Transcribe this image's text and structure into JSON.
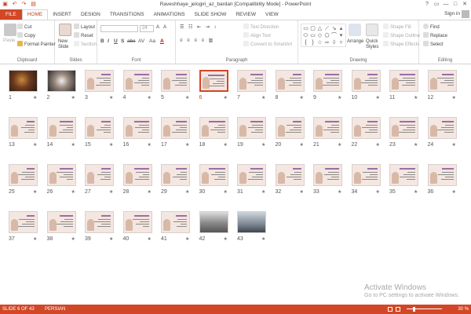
{
  "window": {
    "title": "Raveshhaye_jelogiri_az_bardari [Compatibility Mode] - PowerPoint",
    "qat": [
      "save-icon",
      "undo-icon",
      "redo-icon",
      "slideshow-icon"
    ],
    "controls": [
      "?",
      "▭",
      "—",
      "□",
      "✕"
    ]
  },
  "tabs": [
    "FILE",
    "HOME",
    "INSERT",
    "DESIGN",
    "TRANSITIONS",
    "ANIMATIONS",
    "SLIDE SHOW",
    "REVIEW",
    "VIEW"
  ],
  "active_tab": "HOME",
  "signin": "Sign in",
  "ribbon": {
    "clipboard": {
      "label": "Clipboard",
      "paste": "Paste",
      "cut": "Cut",
      "copy": "Copy",
      "format_painter": "Format Painter"
    },
    "slides": {
      "label": "Slides",
      "new_slide": "New",
      "new_slide2": "Slide",
      "layout": "Layout",
      "reset": "Reset",
      "section": "Section"
    },
    "font": {
      "label": "Font",
      "size": "24",
      "bold": "B",
      "italic": "I",
      "underline": "U",
      "strike": "S",
      "shadow": "abc",
      "spacing": "AV",
      "case": "Aa",
      "color": "A"
    },
    "paragraph": {
      "label": "Paragraph",
      "text_direction": "Text Direction",
      "align_text": "Align Text",
      "smartart": "Convert to SmartArt"
    },
    "drawing": {
      "label": "Drawing",
      "arrange": "Arrange",
      "quick_styles": "Quick",
      "quick_styles2": "Styles",
      "shape_fill": "Shape Fill",
      "shape_outline": "Shape Outline",
      "shape_effects": "Shape Effects"
    },
    "editing": {
      "label": "Editing",
      "find": "Find",
      "replace": "Replace",
      "select": "Select"
    }
  },
  "slides": [
    {
      "n": "1"
    },
    {
      "n": "2"
    },
    {
      "n": "3"
    },
    {
      "n": "4"
    },
    {
      "n": "5"
    },
    {
      "n": "6"
    },
    {
      "n": "7"
    },
    {
      "n": "8"
    },
    {
      "n": "9"
    },
    {
      "n": "10"
    },
    {
      "n": "11"
    },
    {
      "n": "12"
    },
    {
      "n": "13"
    },
    {
      "n": "14"
    },
    {
      "n": "15"
    },
    {
      "n": "16"
    },
    {
      "n": "17"
    },
    {
      "n": "18"
    },
    {
      "n": "19"
    },
    {
      "n": "20"
    },
    {
      "n": "21"
    },
    {
      "n": "22"
    },
    {
      "n": "23"
    },
    {
      "n": "24"
    },
    {
      "n": "25"
    },
    {
      "n": "26"
    },
    {
      "n": "27"
    },
    {
      "n": "28"
    },
    {
      "n": "29"
    },
    {
      "n": "30"
    },
    {
      "n": "31"
    },
    {
      "n": "32"
    },
    {
      "n": "33"
    },
    {
      "n": "34"
    },
    {
      "n": "35"
    },
    {
      "n": "36"
    },
    {
      "n": "37"
    },
    {
      "n": "38"
    },
    {
      "n": "39"
    },
    {
      "n": "40"
    },
    {
      "n": "41"
    },
    {
      "n": "42"
    },
    {
      "n": "43"
    }
  ],
  "selected_slide": "6",
  "watermark": {
    "title": "Activate Windows",
    "subtitle": "Go to PC settings to activate Windows."
  },
  "status": {
    "slide": "SLIDE 6 OF 43",
    "language": "PERSIAN",
    "zoom": "30 %"
  },
  "colors": {
    "accent": "#d24726",
    "thumb_bg": "#f4e6e0"
  }
}
